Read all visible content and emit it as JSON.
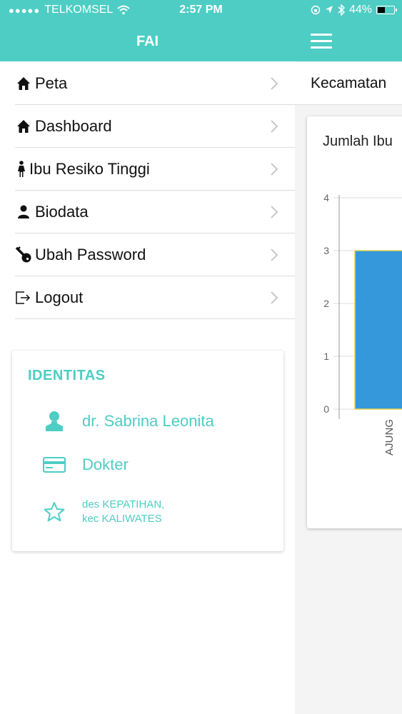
{
  "status_bar": {
    "carrier": "TELKOMSEL",
    "time": "2:57 PM",
    "battery": "44%",
    "icons": [
      "signal-dots",
      "wifi-icon",
      "rotation-lock-icon",
      "location-icon",
      "bluetooth-icon",
      "battery-icon"
    ]
  },
  "menu": {
    "title": "FAI",
    "items": [
      {
        "label": "Peta",
        "icon": "home-icon"
      },
      {
        "label": "Dashboard",
        "icon": "home-icon"
      },
      {
        "label": "Ibu Resiko Tinggi",
        "icon": "woman-icon"
      },
      {
        "label": "Biodata",
        "icon": "person-icon"
      },
      {
        "label": "Ubah Password",
        "icon": "key-icon"
      },
      {
        "label": "Logout",
        "icon": "logout-icon"
      }
    ]
  },
  "identity": {
    "title": "IDENTITAS",
    "name": "dr. Sabrina Leonita",
    "role": "Dokter",
    "address_line1": "des KEPATIHAN,",
    "address_line2": "kec KALIWATES"
  },
  "main": {
    "filter_label": "Kecamatan",
    "chart_title": "Jumlah Ibu"
  },
  "chart_data": {
    "type": "bar",
    "categories": [
      "AJUNG"
    ],
    "values": [
      3
    ],
    "title": "Jumlah Ibu",
    "xlabel": "",
    "ylabel": "",
    "ylim": [
      0,
      4
    ],
    "yticks": [
      "0",
      "1",
      "2",
      "3",
      "4"
    ],
    "grid": true
  },
  "colors": {
    "accent": "#4ecdc4",
    "bar": "#3498db",
    "bar_border": "#e8d44d"
  }
}
